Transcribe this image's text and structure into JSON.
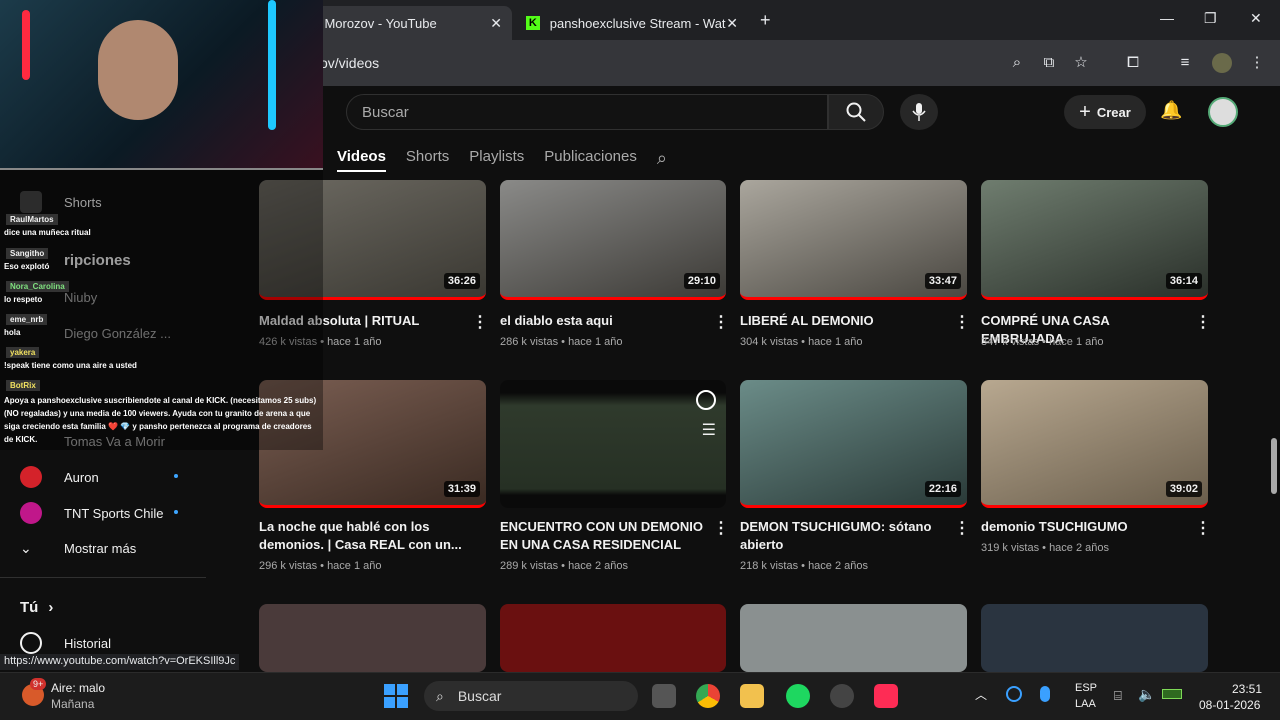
{
  "browser": {
    "tabs": [
      {
        "label": "m Morozov - YouTube",
        "active": true
      },
      {
        "label": "panshoexclusive Stream - Watc",
        "active": false
      }
    ],
    "new_tab": "+",
    "url": "ov/videos",
    "window_controls": [
      "—",
      "❐",
      "✕"
    ]
  },
  "youtube": {
    "search_placeholder": "Buscar",
    "create_label": "Crear",
    "channel_tabs": [
      "Videos",
      "Shorts",
      "Playlists",
      "Publicaciones"
    ],
    "active_tab": "Videos"
  },
  "sidebar": {
    "shorts": "Shorts",
    "subscriptions": "ripciones",
    "subs": [
      "Niuby",
      "Diego González ...",
      "Tomas Va a Morir",
      "Auron",
      "TNT Sports Chile"
    ],
    "show_more": "Mostrar más",
    "you": "Tú",
    "history": "Historial"
  },
  "videos": [
    {
      "title": "Maldad absoluta | RITUAL",
      "views": "426 k vistas",
      "age": "hace 1 año",
      "duration": "36:26"
    },
    {
      "title": "el diablo esta aqui",
      "views": "286 k vistas",
      "age": "hace 1 año",
      "duration": "29:10"
    },
    {
      "title": "LIBERÉ AL DEMONIO",
      "views": "304 k vistas",
      "age": "hace 1 año",
      "duration": "33:47"
    },
    {
      "title": "COMPRÉ UNA CASA EMBRUJADA",
      "views": "347 k vistas",
      "age": "hace 1 año",
      "duration": "36:14"
    },
    {
      "title": "La noche que hablé con los demonios. | Casa REAL con un...",
      "views": "296 k vistas",
      "age": "hace 1 año",
      "duration": "31:39"
    },
    {
      "title": "ENCUENTRO CON UN DEMONIO EN UNA CASA RESIDENCIAL",
      "views": "289 k vistas",
      "age": "hace 2 años",
      "duration": ""
    },
    {
      "title": "DEMON TSUCHIGUMO: sótano abierto",
      "views": "218 k vistas",
      "age": "hace 2 años",
      "duration": "22:16"
    },
    {
      "title": "demonio TSUCHIGUMO",
      "views": "319 k vistas",
      "age": "hace 2 años",
      "duration": "39:02"
    }
  ],
  "stream_chat": [
    {
      "user": "RaulMartos",
      "msg": "dice una muñeca ritual",
      "color": "#f1f1f1"
    },
    {
      "user": "Sangitho",
      "msg": "Eso explotó",
      "color": "#f1f1f1"
    },
    {
      "user": "Nora_Carolina",
      "msg": "lo respeto",
      "color": "#7fe07f"
    },
    {
      "user": "eme_nrb",
      "msg": "hola",
      "color": "#f1f1f1"
    },
    {
      "user": "yakera",
      "msg": "!speak tiene como una aire a usted",
      "color": "#f0e060"
    },
    {
      "user": "BotRix",
      "msg": "Apoya a panshoexclusive suscribiendote al canal de KICK. (necesitamos 25 subs) (NO regaladas) y una media de 100 viewers. Ayuda con tu granito de arena a que siga creciendo esta familia ❤️ 💎 y pansho pertenezca al programa de creadores de KICK.",
      "color": "#f0e060"
    }
  ],
  "status_url": "https://www.youtube.com/watch?v=OrEKSIll9Jc",
  "taskbar": {
    "weather_badge": "9+",
    "weather_title": "Aire: malo",
    "weather_sub": "Mañana",
    "search": "Buscar",
    "lang1": "ESP",
    "lang2": "LAA",
    "time": "23:51",
    "date": "08-01-2026"
  }
}
